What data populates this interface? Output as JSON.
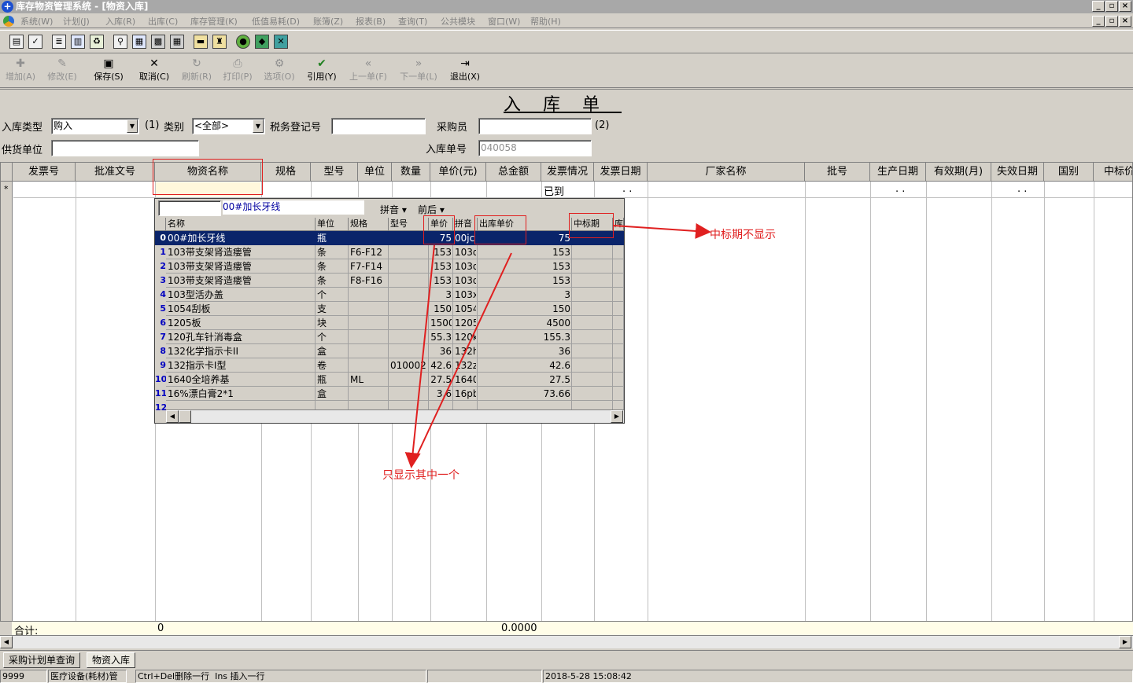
{
  "window": {
    "title": "库存物资管理系统 - [物资入库]",
    "app_icon": "+"
  },
  "menu": [
    "系统(W)",
    "计划(J)",
    "入库(R)",
    "出库(C)",
    "库存管理(K)",
    "低值易耗(D)",
    "账簿(Z)",
    "报表(B)",
    "查询(T)",
    "公共模块",
    "窗口(W)",
    "帮助(H)"
  ],
  "toolbar2": [
    {
      "label": "增加(A)",
      "icon": "add-icon",
      "enabled": false
    },
    {
      "label": "修改(E)",
      "icon": "edit-icon",
      "enabled": false
    },
    {
      "label": "保存(S)",
      "icon": "save-icon",
      "enabled": true
    },
    {
      "label": "取消(C)",
      "icon": "cancel-icon",
      "enabled": true
    },
    {
      "label": "刷新(R)",
      "icon": "refresh-icon",
      "enabled": false
    },
    {
      "label": "打印(P)",
      "icon": "print-icon",
      "enabled": false
    },
    {
      "label": "选项(O)",
      "icon": "options-icon",
      "enabled": false
    },
    {
      "label": "引用(Y)",
      "icon": "reference-icon",
      "enabled": true
    },
    {
      "label": "上一单(F)",
      "icon": "prev-icon",
      "enabled": false
    },
    {
      "label": "下一单(L)",
      "icon": "next-icon",
      "enabled": false
    },
    {
      "label": "退出(X)",
      "icon": "exit-icon",
      "enabled": true
    }
  ],
  "form": {
    "heading": "入库单",
    "type_label": "入库类型",
    "type_value": "购入",
    "note1": "(1)",
    "category_label": "类别",
    "category_value": "<全部>",
    "tax_label": "税务登记号",
    "tax_value": "",
    "buyer_label": "采购员",
    "buyer_value": "",
    "note2": "(2)",
    "supplier_label": "供货单位",
    "supplier_value": "",
    "order_label": "入库单号",
    "order_value": "040058"
  },
  "grid": {
    "columns": [
      "发票号",
      "批准文号",
      "物资名称",
      "规格",
      "型号",
      "单位",
      "数量",
      "单价(元)",
      "总金额",
      "发票情况",
      "发票日期",
      "厂家名称",
      "批号",
      "生产日期",
      "有效期(月)",
      "失效日期",
      "国别",
      "中标价"
    ],
    "new_row_marker": "*",
    "invoice_status": "已到",
    "date_placeholder": ". .",
    "sum_label": "合计:",
    "sum_count": "0",
    "sum_amount": "0.0000"
  },
  "popup": {
    "search_value": "",
    "hint": "00#加长牙线",
    "mode1": "拼音",
    "mode2": "前后",
    "columns": [
      "名称",
      "单位",
      "规格",
      "型号",
      "单价",
      "拼音",
      "出库单价",
      "中标期",
      "库"
    ],
    "rows": [
      {
        "i": "0",
        "name": "00#加长牙线",
        "unit": "瓶",
        "spec": "",
        "model": "",
        "price": "75",
        "py": "00jc",
        "out": "75"
      },
      {
        "i": "1",
        "name": "103带支架肾造瘘管",
        "unit": "条",
        "spec": "F6-F12",
        "model": "",
        "price": "153",
        "py": "103d",
        "out": "153"
      },
      {
        "i": "2",
        "name": "103带支架肾造瘘管",
        "unit": "条",
        "spec": "F7-F14",
        "model": "",
        "price": "153",
        "py": "103d",
        "out": "153"
      },
      {
        "i": "3",
        "name": "103带支架肾造瘘管",
        "unit": "条",
        "spec": "F8-F16",
        "model": "",
        "price": "153",
        "py": "103d",
        "out": "153"
      },
      {
        "i": "4",
        "name": "103型活办盖",
        "unit": "个",
        "spec": "",
        "model": "",
        "price": "3",
        "py": "103x",
        "out": "3"
      },
      {
        "i": "5",
        "name": "1054刮板",
        "unit": "支",
        "spec": "",
        "model": "",
        "price": "150",
        "py": "1054",
        "out": "150"
      },
      {
        "i": "6",
        "name": "1205板",
        "unit": "块",
        "spec": "",
        "model": "",
        "price": "1500",
        "py": "1205",
        "out": "4500"
      },
      {
        "i": "7",
        "name": "120孔车针消毒盒",
        "unit": "个",
        "spec": "",
        "model": "",
        "price": "55.3",
        "py": "120k",
        "out": "155.3"
      },
      {
        "i": "8",
        "name": "132化学指示卡II",
        "unit": "盒",
        "spec": "",
        "model": "",
        "price": "36",
        "py": "132h",
        "out": "36"
      },
      {
        "i": "9",
        "name": "132指示卡I型",
        "unit": "卷",
        "spec": "",
        "model": "010002",
        "price": "42.6",
        "py": "132z",
        "out": "42.6"
      },
      {
        "i": "10",
        "name": "1640全培养基",
        "unit": "瓶",
        "spec": "ML",
        "model": "",
        "price": "27.5",
        "py": "1640",
        "out": "27.5"
      },
      {
        "i": "11",
        "name": "16%漂白膏2*1",
        "unit": "盒",
        "spec": "",
        "model": "",
        "price": "3.6",
        "py": "16pb",
        "out": "73.66"
      },
      {
        "i": "12",
        "name": "",
        "unit": "",
        "spec": "",
        "model": "",
        "price": "",
        "py": "",
        "out": ""
      }
    ]
  },
  "annotations": {
    "a1": "中标期不显示",
    "a2": "只显示其中一个"
  },
  "tabs": [
    "采购计划单查询",
    "物资入库"
  ],
  "status": {
    "s1": "9999",
    "s2": "医疗设备(耗材)管",
    "s3": "Ctrl+Del删除一行  Ins 插入一行",
    "s4": "",
    "s5": "2018-5-28 15:08:42"
  },
  "colors": {
    "accent_red": "#e02020",
    "selection": "#0a246a"
  }
}
